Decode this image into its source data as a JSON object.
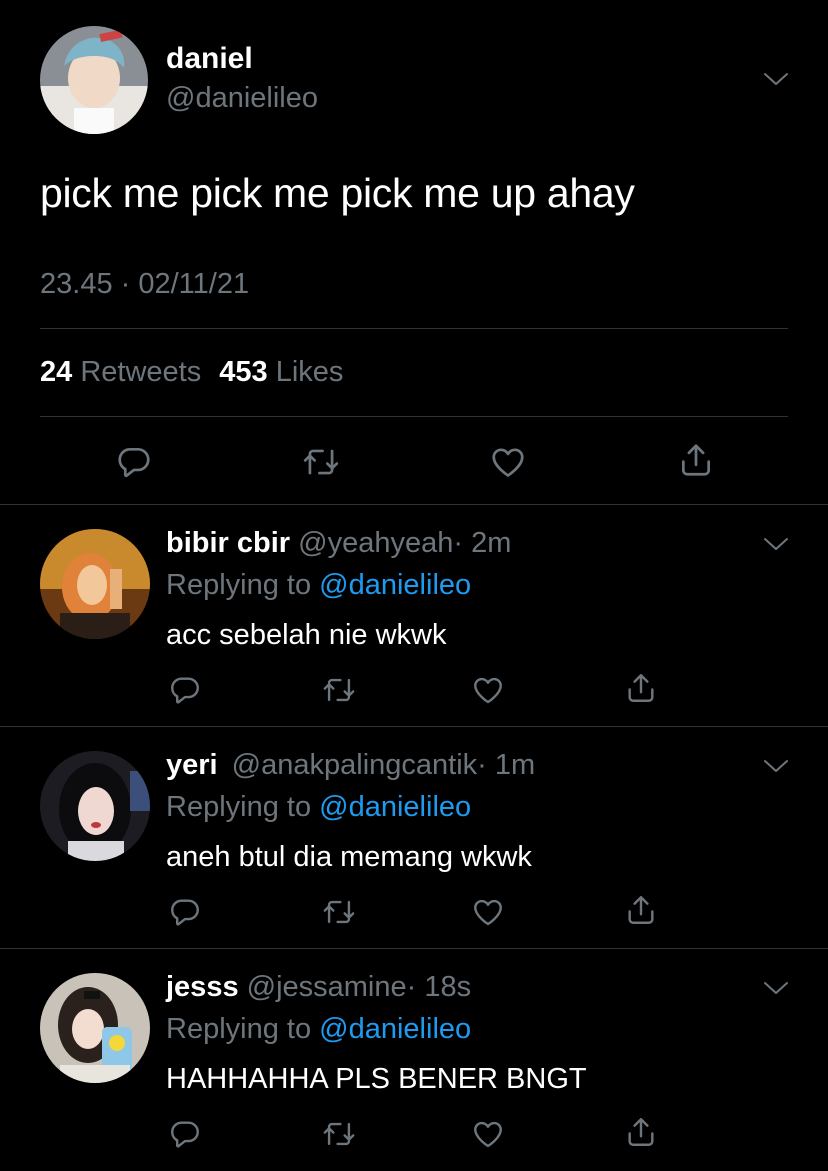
{
  "main_tweet": {
    "name": "daniel",
    "handle": "@danielileo",
    "text": "pick me pick me pick me up ahay",
    "meta": "23.45 · 02/11/21",
    "retweets": "24",
    "retweets_label": "Retweets",
    "likes": "453",
    "likes_label": "Likes"
  },
  "replies": [
    {
      "name": "bibir cbir",
      "handle": "@yeahyeah",
      "time": "· 2m",
      "replying_prefix": "Replying to",
      "replying_to": "@danielileo",
      "text": "acc sebelah nie wkwk"
    },
    {
      "name": "yeri",
      "handle": "@anakpalingcantik",
      "time": "· 1m",
      "replying_prefix": "Replying to",
      "replying_to": "@danielileo",
      "text": "aneh btul dia memang wkwk"
    },
    {
      "name": "jesss",
      "handle": "@jessamine",
      "time": "· 18s",
      "replying_prefix": "Replying to",
      "replying_to": "@danielileo",
      "text": "HAHHAHHA PLS BENER BNGT"
    }
  ],
  "icons": {
    "reply": "reply-icon",
    "retweet": "retweet-icon",
    "like": "heart-icon",
    "share": "share-icon",
    "more": "chevron-down-icon"
  },
  "colors": {
    "background": "#000000",
    "secondary_text": "#6e767d",
    "link": "#1d9bf0",
    "divider": "#2f3336"
  }
}
